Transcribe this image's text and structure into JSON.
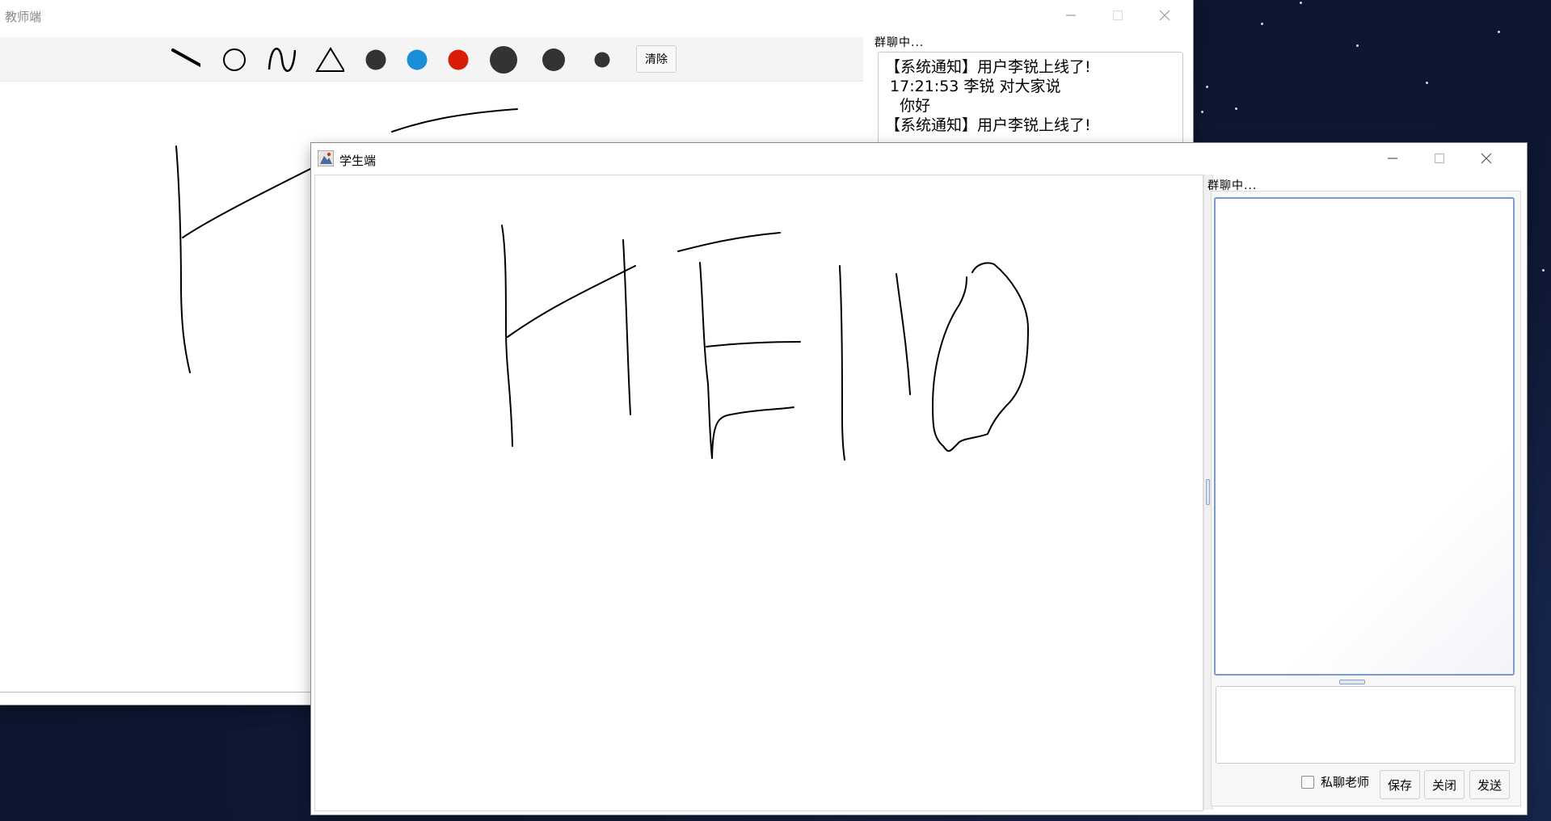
{
  "teacher_window": {
    "title": "教师端",
    "toolbar": {
      "tools": [
        "line-tool",
        "circle-tool",
        "curve-tool",
        "triangle-tool"
      ],
      "colors": [
        "#333333",
        "#1a8fd6",
        "#d81e06"
      ],
      "sizes": [
        "large",
        "medium",
        "small"
      ],
      "clear_label": "清除"
    },
    "chat_label": "群聊中...",
    "chat_messages": [
      "【系统通知】用户李锐上线了!",
      " 17:21:53 李锐 对大家说",
      "   你好",
      "【系统通知】用户李锐上线了!"
    ]
  },
  "student_window": {
    "title": "学生端",
    "chat_label": "群聊中...",
    "private_label": "私聊老师",
    "private_checked": false,
    "buttons": {
      "save": "保存",
      "close": "关闭",
      "send": "发送"
    }
  }
}
